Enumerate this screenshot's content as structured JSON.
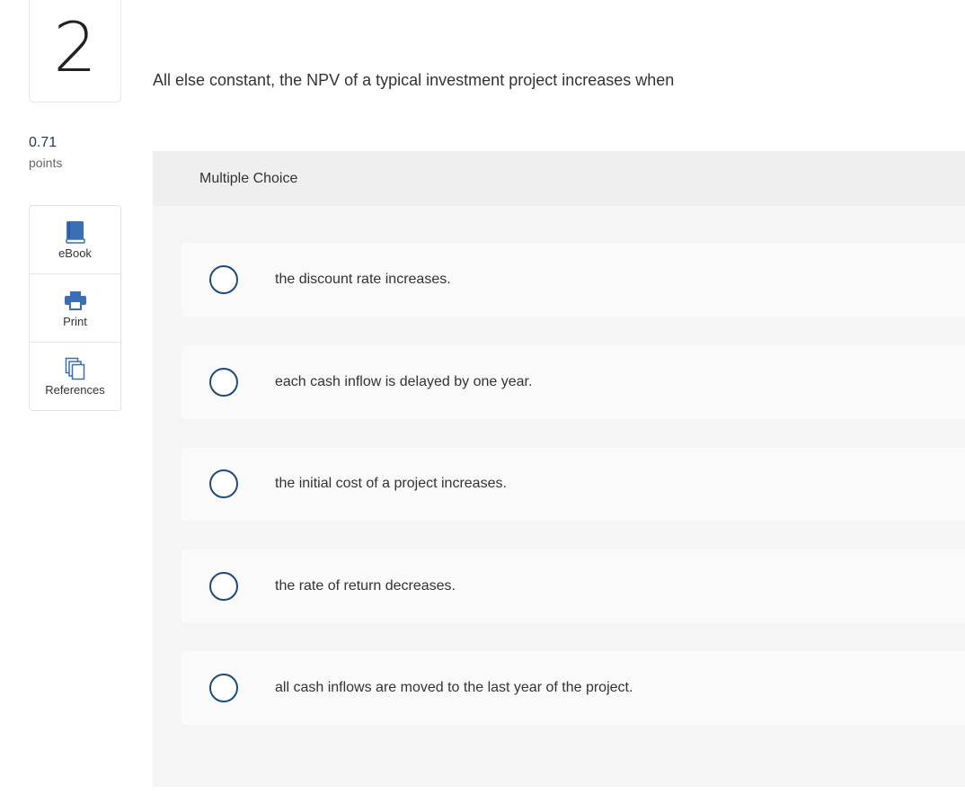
{
  "question": {
    "number": "2",
    "points_value": "0.71",
    "points_label": "points",
    "text": "All else constant, the NPV of a typical investment project increases when"
  },
  "tools": [
    {
      "label": "eBook",
      "icon": "book-icon",
      "color": "#3a6fb5"
    },
    {
      "label": "Print",
      "icon": "printer-icon",
      "color": "#3a6fb5"
    },
    {
      "label": "References",
      "icon": "documents-icon",
      "color": "#3a6fb5"
    }
  ],
  "multiple_choice": {
    "header": "Multiple Choice",
    "options": [
      {
        "label": "the discount rate increases."
      },
      {
        "label": "each cash inflow is delayed by one year."
      },
      {
        "label": "the initial cost of a project increases."
      },
      {
        "label": "the rate of return decreases."
      },
      {
        "label": "all cash inflows are moved to the last year of the project."
      }
    ]
  },
  "colors": {
    "accent": "#3a6fb5",
    "radio_border": "#1f4b7a",
    "panel_bg": "#f5f5f5",
    "choice_bg": "#fafafa"
  }
}
